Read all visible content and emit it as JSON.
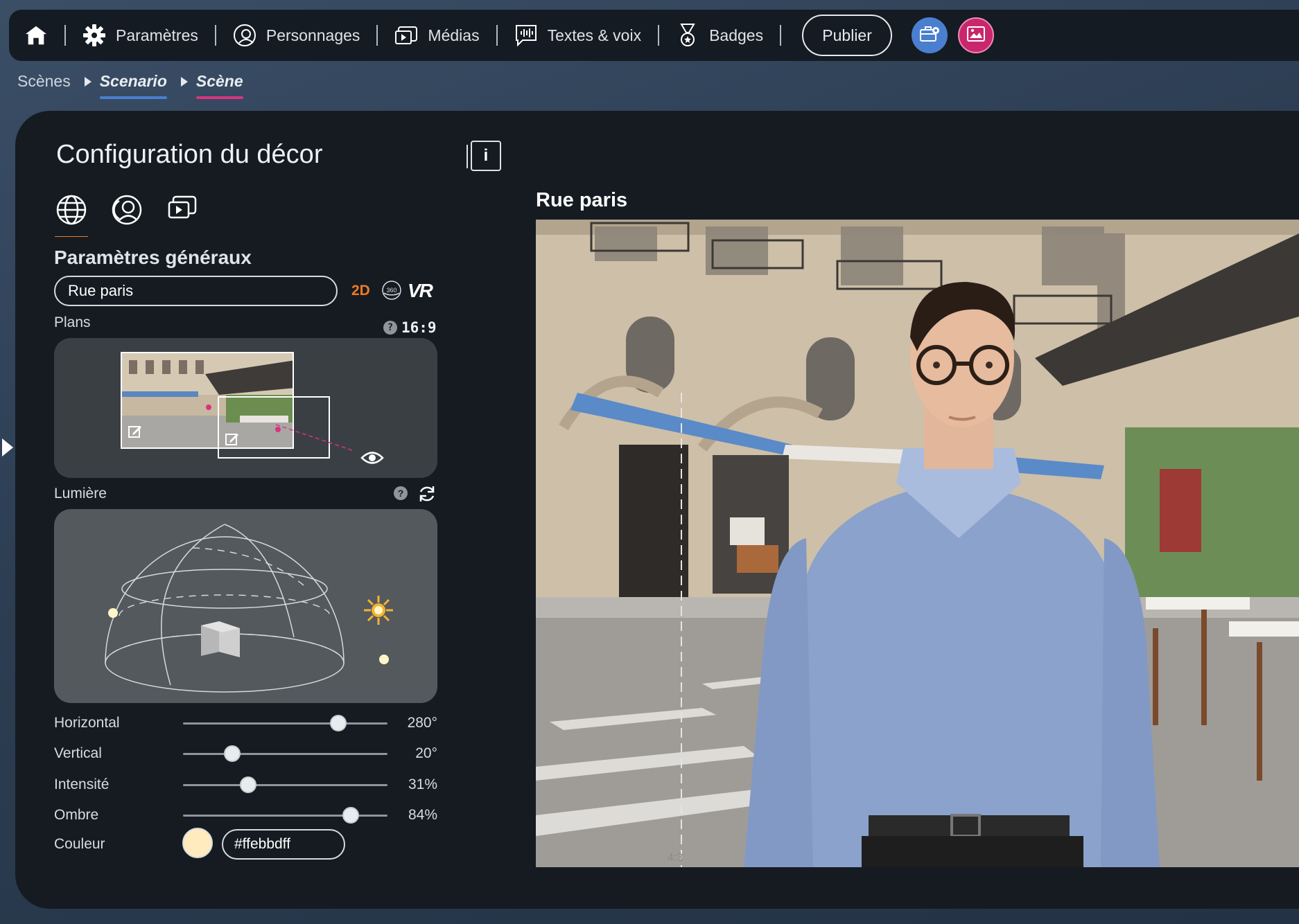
{
  "nav": {
    "items": [
      {
        "label": "Paramètres",
        "icon": "gear-icon"
      },
      {
        "label": "Personnages",
        "icon": "character-icon"
      },
      {
        "label": "Médias",
        "icon": "media-icon"
      },
      {
        "label": "Textes & voix",
        "icon": "speech-icon"
      },
      {
        "label": "Badges",
        "icon": "medal-icon"
      }
    ],
    "publish_label": "Publier"
  },
  "breadcrumb": {
    "scenes": "Scènes",
    "scenario": "Scenario",
    "scene": "Scène"
  },
  "config": {
    "title": "Configuration du décor",
    "info_label": "i",
    "section_title": "Paramètres généraux",
    "decor_name": "Rue paris",
    "modes": {
      "mode_2d": "2D",
      "mode_360": "360",
      "mode_vr": "VR"
    },
    "plans_label": "Plans",
    "ratio": "16:9",
    "light_label": "Lumière",
    "sliders": [
      {
        "label": "Horizontal",
        "value": "280°",
        "percent": 76
      },
      {
        "label": "Vertical",
        "value": "20°",
        "percent": 24
      },
      {
        "label": "Intensité",
        "value": "31%",
        "percent": 32
      },
      {
        "label": "Ombre",
        "value": "84%",
        "percent": 82
      }
    ],
    "color_label": "Couleur",
    "color_value": "#ffebbdff"
  },
  "preview": {
    "title": "Rue paris",
    "ratio_mark": "4:3"
  },
  "colors": {
    "accent_orange": "#ef7a23",
    "scenario_underline": "#4a7fd0",
    "scene_underline": "#d8347e",
    "light_color": "#ffebbd"
  }
}
